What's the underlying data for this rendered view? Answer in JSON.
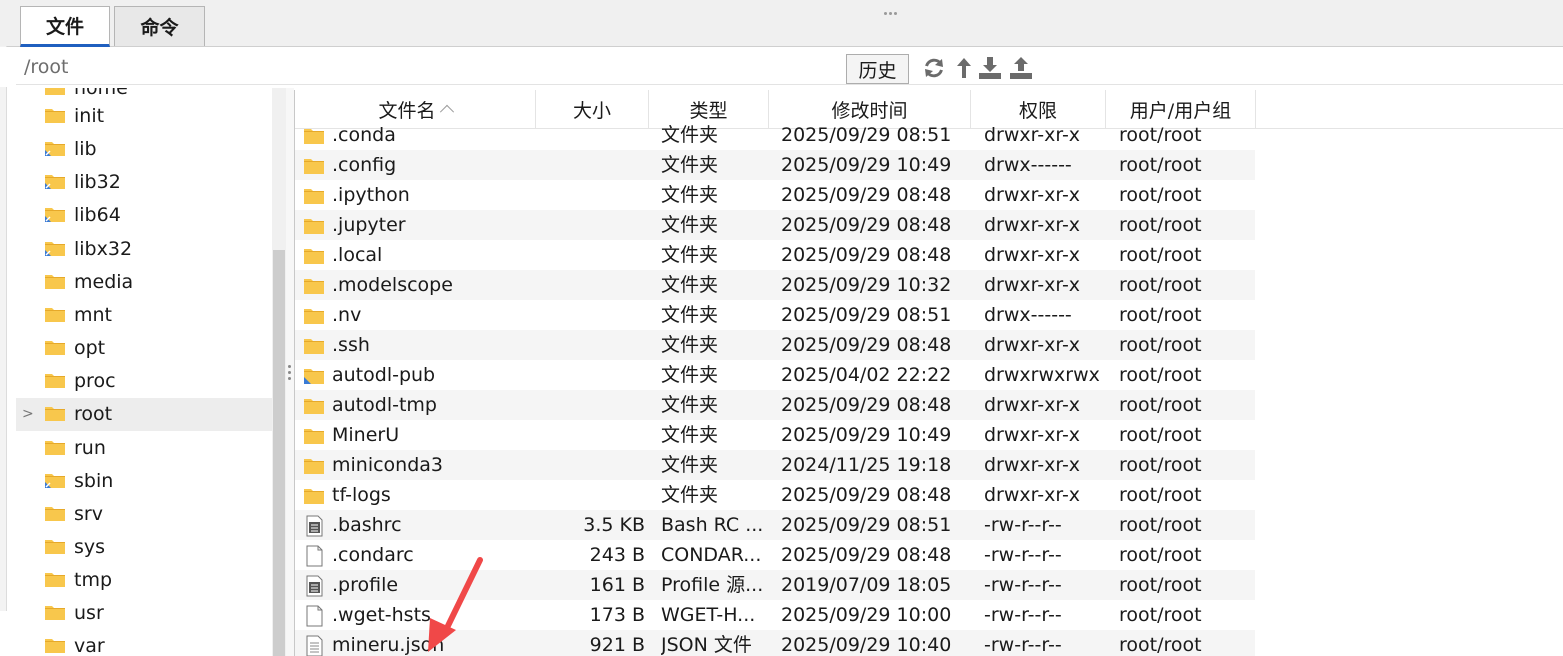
{
  "tabs": [
    {
      "label": "文件",
      "active": true
    },
    {
      "label": "命令",
      "active": false
    }
  ],
  "path": {
    "value": "/root"
  },
  "toolbar": {
    "history_label": "历史",
    "icons": [
      "refresh-icon",
      "go-up-icon",
      "download-icon",
      "upload-icon"
    ]
  },
  "tree": {
    "partial_top_label": "home",
    "items": [
      {
        "label": "init",
        "link": false
      },
      {
        "label": "lib",
        "link": true
      },
      {
        "label": "lib32",
        "link": true
      },
      {
        "label": "lib64",
        "link": true
      },
      {
        "label": "libx32",
        "link": true
      },
      {
        "label": "media",
        "link": false
      },
      {
        "label": "mnt",
        "link": false
      },
      {
        "label": "opt",
        "link": false
      },
      {
        "label": "proc",
        "link": false
      },
      {
        "label": "root",
        "link": false,
        "selected": true
      },
      {
        "label": "run",
        "link": false
      },
      {
        "label": "sbin",
        "link": true
      },
      {
        "label": "srv",
        "link": false
      },
      {
        "label": "sys",
        "link": false
      },
      {
        "label": "tmp",
        "link": false
      },
      {
        "label": "usr",
        "link": false
      },
      {
        "label": "var",
        "link": false
      }
    ]
  },
  "columns": {
    "name": "文件名",
    "size": "大小",
    "type": "类型",
    "modified": "修改时间",
    "permissions": "权限",
    "owner": "用户/用户组"
  },
  "files": [
    {
      "name": ".conda",
      "size": "",
      "type": "文件夹",
      "modified": "2025/09/29 08:51",
      "perm": "drwxr-xr-x",
      "owner": "root/root",
      "icon": "folder"
    },
    {
      "name": ".config",
      "size": "",
      "type": "文件夹",
      "modified": "2025/09/29 10:49",
      "perm": "drwx------",
      "owner": "root/root",
      "icon": "folder"
    },
    {
      "name": ".ipython",
      "size": "",
      "type": "文件夹",
      "modified": "2025/09/29 08:48",
      "perm": "drwxr-xr-x",
      "owner": "root/root",
      "icon": "folder"
    },
    {
      "name": ".jupyter",
      "size": "",
      "type": "文件夹",
      "modified": "2025/09/29 08:48",
      "perm": "drwxr-xr-x",
      "owner": "root/root",
      "icon": "folder"
    },
    {
      "name": ".local",
      "size": "",
      "type": "文件夹",
      "modified": "2025/09/29 08:48",
      "perm": "drwxr-xr-x",
      "owner": "root/root",
      "icon": "folder"
    },
    {
      "name": ".modelscope",
      "size": "",
      "type": "文件夹",
      "modified": "2025/09/29 10:32",
      "perm": "drwxr-xr-x",
      "owner": "root/root",
      "icon": "folder"
    },
    {
      "name": ".nv",
      "size": "",
      "type": "文件夹",
      "modified": "2025/09/29 08:51",
      "perm": "drwx------",
      "owner": "root/root",
      "icon": "folder"
    },
    {
      "name": ".ssh",
      "size": "",
      "type": "文件夹",
      "modified": "2025/09/29 08:48",
      "perm": "drwxr-xr-x",
      "owner": "root/root",
      "icon": "folder"
    },
    {
      "name": "autodl-pub",
      "size": "",
      "type": "文件夹",
      "modified": "2025/04/02 22:22",
      "perm": "drwxrwxrwx",
      "owner": "root/root",
      "icon": "folder-link"
    },
    {
      "name": "autodl-tmp",
      "size": "",
      "type": "文件夹",
      "modified": "2025/09/29 08:48",
      "perm": "drwxr-xr-x",
      "owner": "root/root",
      "icon": "folder"
    },
    {
      "name": "MinerU",
      "size": "",
      "type": "文件夹",
      "modified": "2025/09/29 10:49",
      "perm": "drwxr-xr-x",
      "owner": "root/root",
      "icon": "folder"
    },
    {
      "name": "miniconda3",
      "size": "",
      "type": "文件夹",
      "modified": "2024/11/25 19:18",
      "perm": "drwxr-xr-x",
      "owner": "root/root",
      "icon": "folder"
    },
    {
      "name": "tf-logs",
      "size": "",
      "type": "文件夹",
      "modified": "2025/09/29 08:48",
      "perm": "drwxr-xr-x",
      "owner": "root/root",
      "icon": "folder"
    },
    {
      "name": ".bashrc",
      "size": "3.5 KB",
      "type": "Bash RC ...",
      "modified": "2025/09/29 08:51",
      "perm": "-rw-r--r--",
      "owner": "root/root",
      "icon": "config-file"
    },
    {
      "name": ".condarc",
      "size": "243 B",
      "type": "CONDAR...",
      "modified": "2025/09/29 08:48",
      "perm": "-rw-r--r--",
      "owner": "root/root",
      "icon": "blank-file"
    },
    {
      "name": ".profile",
      "size": "161 B",
      "type": "Profile 源...",
      "modified": "2019/07/09 18:05",
      "perm": "-rw-r--r--",
      "owner": "root/root",
      "icon": "config-file"
    },
    {
      "name": ".wget-hsts",
      "size": "173 B",
      "type": "WGET-H...",
      "modified": "2025/09/29 10:00",
      "perm": "-rw-r--r--",
      "owner": "root/root",
      "icon": "blank-file"
    },
    {
      "name": "mineru.json",
      "size": "921 B",
      "type": "JSON 文件",
      "modified": "2025/09/29 10:40",
      "perm": "-rw-r--r--",
      "owner": "root/root",
      "icon": "text-file"
    }
  ],
  "colors": {
    "folder": "#f8c74c",
    "folder_dark": "#e6a92a",
    "accent": "#1f5fbf",
    "arrow": "#f04848",
    "selected_row": "#ededed",
    "alt_row": "#f5f5f5"
  }
}
